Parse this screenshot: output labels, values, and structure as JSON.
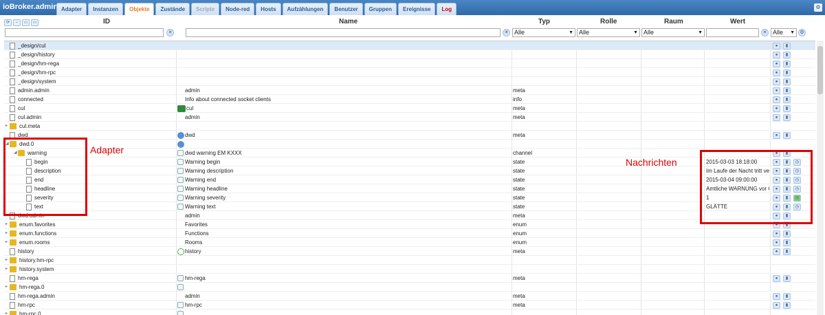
{
  "app": {
    "brand": "ioBroker.admin"
  },
  "tabs": [
    {
      "label": "Adapter",
      "state": ""
    },
    {
      "label": "Instanzen",
      "state": ""
    },
    {
      "label": "Objekte",
      "state": "active"
    },
    {
      "label": "Zustände",
      "state": ""
    },
    {
      "label": "Scripte",
      "state": "disabled"
    },
    {
      "label": "Node-red",
      "state": ""
    },
    {
      "label": "Hosts",
      "state": ""
    },
    {
      "label": "Aufzählungen",
      "state": ""
    },
    {
      "label": "Benutzer",
      "state": ""
    },
    {
      "label": "Gruppen",
      "state": ""
    },
    {
      "label": "Ereignisse",
      "state": ""
    },
    {
      "label": "Log",
      "state": "red"
    }
  ],
  "columns": {
    "id": "ID",
    "name": "Name",
    "type": "Typ",
    "role": "Rolle",
    "room": "Raum",
    "value": "Wert"
  },
  "filters": {
    "type": "Alle",
    "role": "Alle",
    "room": "Alle",
    "value": "Alle"
  },
  "rows": [
    {
      "id": "_design/cul",
      "depth": 0,
      "icon": "file",
      "name": "",
      "nicon": "",
      "type": "",
      "value": "",
      "sel": true,
      "acts": 2
    },
    {
      "id": "_design/history",
      "depth": 0,
      "icon": "file",
      "name": "",
      "nicon": "",
      "type": "",
      "value": "",
      "acts": 2
    },
    {
      "id": "_design/hm-rega",
      "depth": 0,
      "icon": "file",
      "name": "",
      "nicon": "",
      "type": "",
      "value": "",
      "acts": 2
    },
    {
      "id": "_design/hm-rpc",
      "depth": 0,
      "icon": "file",
      "name": "",
      "nicon": "",
      "type": "",
      "value": "",
      "acts": 2
    },
    {
      "id": "_design/system",
      "depth": 0,
      "icon": "file",
      "name": "",
      "nicon": "",
      "type": "",
      "value": "",
      "acts": 2
    },
    {
      "id": "admin.admin",
      "depth": 0,
      "icon": "file",
      "name": "admin",
      "nicon": "",
      "type": "meta",
      "value": "",
      "acts": 2
    },
    {
      "id": "connected",
      "depth": 0,
      "icon": "file",
      "name": "Info about connected socket clients",
      "nicon": "",
      "type": "info",
      "value": "",
      "acts": 2
    },
    {
      "id": "cul",
      "depth": 0,
      "icon": "file",
      "name": "cul",
      "nicon": "cul",
      "type": "meta",
      "value": "",
      "acts": 2
    },
    {
      "id": "cul.admin",
      "depth": 0,
      "icon": "file",
      "name": "admin",
      "nicon": "",
      "type": "meta",
      "value": "",
      "acts": 2
    },
    {
      "id": "cul.meta",
      "depth": 0,
      "icon": "dir",
      "tog": "▸",
      "name": "",
      "nicon": "",
      "type": "",
      "value": "",
      "acts": 0
    },
    {
      "id": "dwd",
      "depth": 0,
      "icon": "file",
      "name": "dwd",
      "nicon": "adapter",
      "type": "meta",
      "value": "",
      "acts": 2
    },
    {
      "id": "dwd.0",
      "depth": 0,
      "icon": "dir",
      "tog": "◢",
      "name": "",
      "nicon": "adapter",
      "type": "",
      "value": "",
      "acts": 0
    },
    {
      "id": "warning",
      "depth": 1,
      "icon": "dir",
      "tog": "◢",
      "name": "dwd warning EM KXXX",
      "nicon": "box",
      "type": "channel",
      "value": "",
      "acts": 2
    },
    {
      "id": "begin",
      "depth": 2,
      "icon": "file",
      "name": "Warning begin",
      "nicon": "box",
      "type": "state",
      "value": "2015-03-03 18:18:00",
      "acts": 3
    },
    {
      "id": "description",
      "depth": 2,
      "icon": "file",
      "name": "Warning description",
      "nicon": "box",
      "type": "state",
      "value": "Im Laufe der Nacht tritt verb",
      "acts": 3
    },
    {
      "id": "end",
      "depth": 2,
      "icon": "file",
      "name": "Warning end",
      "nicon": "box",
      "type": "state",
      "value": "2015-03-04 09:00:00",
      "acts": 3
    },
    {
      "id": "headline",
      "depth": 2,
      "icon": "file",
      "name": "Warning headline",
      "nicon": "box",
      "type": "state",
      "value": "Amtliche WARNUNG vor GL",
      "acts": 3
    },
    {
      "id": "severity",
      "depth": 2,
      "icon": "file",
      "name": "Warning severity",
      "nicon": "box",
      "type": "state",
      "value": "1",
      "acts": 3,
      "green": true
    },
    {
      "id": "text",
      "depth": 2,
      "icon": "file",
      "name": "Warning text",
      "nicon": "box",
      "type": "state",
      "value": "GLÄTTE",
      "acts": 3
    },
    {
      "id": "dwd.admin",
      "depth": 0,
      "icon": "file",
      "name": "admin",
      "nicon": "",
      "type": "meta",
      "value": "",
      "acts": 2
    },
    {
      "id": "enum.favorites",
      "depth": 0,
      "icon": "dir",
      "tog": "▸",
      "name": "Favorites",
      "nicon": "",
      "type": "enum",
      "value": "",
      "acts": 2
    },
    {
      "id": "enum.functions",
      "depth": 0,
      "icon": "dir",
      "tog": "▸",
      "name": "Functions",
      "nicon": "",
      "type": "enum",
      "value": "",
      "acts": 2
    },
    {
      "id": "enum.rooms",
      "depth": 0,
      "icon": "dir",
      "tog": "▸",
      "name": "Rooms",
      "nicon": "",
      "type": "enum",
      "value": "",
      "acts": 2
    },
    {
      "id": "history",
      "depth": 0,
      "icon": "file",
      "name": "history",
      "nicon": "hist",
      "type": "meta",
      "value": "",
      "acts": 2
    },
    {
      "id": "history.hm-rpc",
      "depth": 0,
      "icon": "dir",
      "tog": "▸",
      "name": "",
      "nicon": "",
      "type": "",
      "value": "",
      "acts": 0
    },
    {
      "id": "history.system",
      "depth": 0,
      "icon": "dir",
      "tog": "▸",
      "name": "",
      "nicon": "",
      "type": "",
      "value": "",
      "acts": 0
    },
    {
      "id": "hm-rega",
      "depth": 0,
      "icon": "file",
      "name": "hm-rega",
      "nicon": "doc",
      "type": "meta",
      "value": "",
      "acts": 2
    },
    {
      "id": "hm-rega.0",
      "depth": 0,
      "icon": "dir",
      "tog": "▸",
      "name": "",
      "nicon": "doc",
      "type": "",
      "value": "",
      "acts": 0
    },
    {
      "id": "hm-rega.admin",
      "depth": 0,
      "icon": "file",
      "name": "admin",
      "nicon": "",
      "type": "meta",
      "value": "",
      "acts": 2
    },
    {
      "id": "hm-rpc",
      "depth": 0,
      "icon": "file",
      "name": "hm-rpc",
      "nicon": "doc",
      "type": "meta",
      "value": "",
      "acts": 2
    },
    {
      "id": "hm-rpc.0",
      "depth": 0,
      "icon": "dir",
      "tog": "▸",
      "name": "",
      "nicon": "doc",
      "type": "",
      "value": "",
      "acts": 0
    }
  ],
  "annotations": {
    "adapter": "Adapter",
    "messages": "Nachrichten"
  },
  "icons": {
    "clear": "clear-icon",
    "edit": "edit-icon",
    "delete": "delete-icon",
    "history": "history-icon"
  }
}
